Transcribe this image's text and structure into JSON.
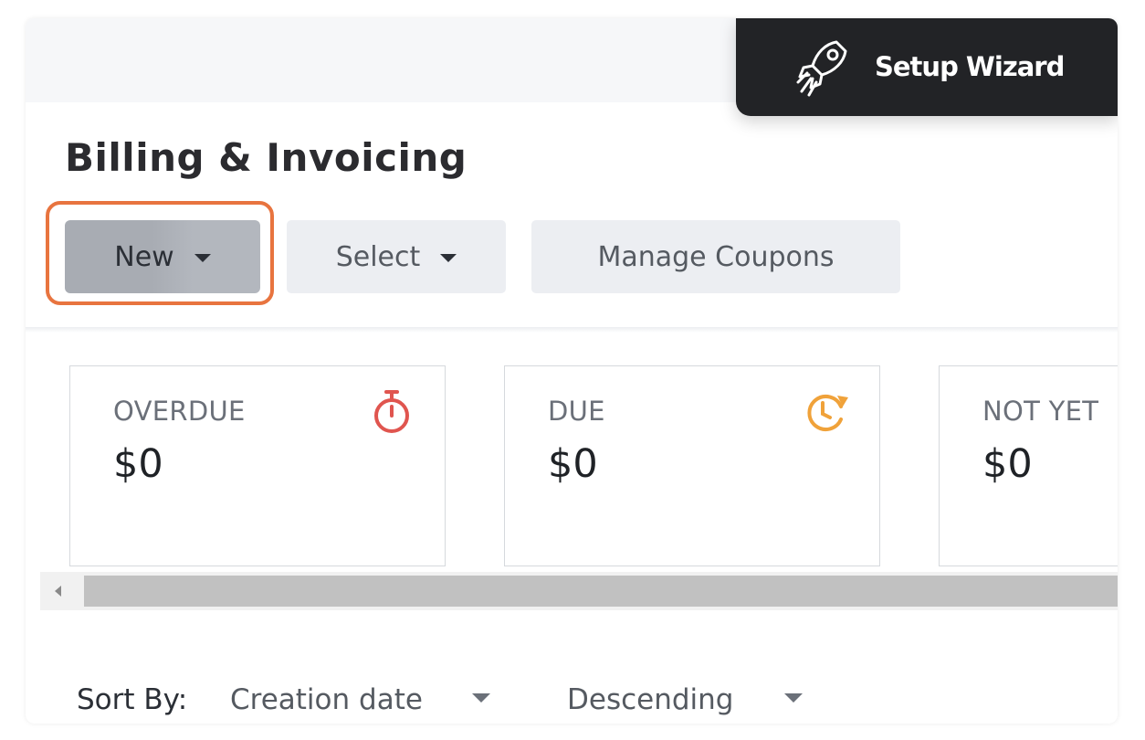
{
  "header": {
    "wizard_label": "Setup Wizard",
    "wizard_icon": "rocket-icon"
  },
  "page": {
    "title": "Billing & Invoicing"
  },
  "toolbar": {
    "new_label": "New",
    "select_label": "Select",
    "coupons_label": "Manage Coupons",
    "highlight_color": "#e8743f"
  },
  "cards": [
    {
      "label": "OVERDUE",
      "value": "$0",
      "icon": "stopwatch-icon",
      "icon_color": "#e0554f"
    },
    {
      "label": "DUE",
      "value": "$0",
      "icon": "clock-refresh-icon",
      "icon_color": "#f0a23a"
    },
    {
      "label": "NOT YET",
      "value": "$0"
    }
  ],
  "sort": {
    "label": "Sort By:",
    "field_value": "Creation date",
    "order_value": "Descending"
  }
}
